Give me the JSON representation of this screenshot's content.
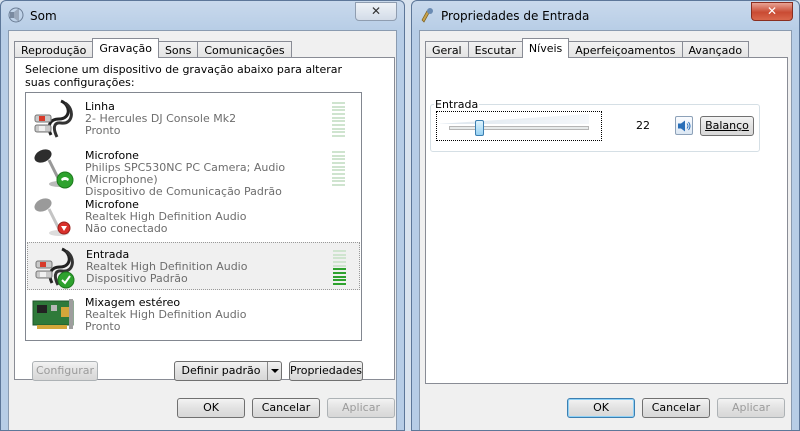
{
  "sound_window": {
    "title": "Som",
    "close_label": "✕",
    "tabs": [
      {
        "label": "Reprodução"
      },
      {
        "label": "Gravação"
      },
      {
        "label": "Sons"
      },
      {
        "label": "Comunicações"
      }
    ],
    "instructions": "Selecione um dispositivo de gravação abaixo para alterar suas configurações:",
    "devices": [
      {
        "name": "Linha",
        "line2": "2- Hercules DJ Console Mk2",
        "line3": "Pronto",
        "icon": "rca-cable-icon"
      },
      {
        "name": "Microfone",
        "line2": "Philips SPC530NC PC Camera; Audio (Microphone)",
        "line3": "Dispositivo de Comunicação Padrão",
        "icon": "microphone-phone-icon"
      },
      {
        "name": "Microfone",
        "line2": "Realtek High Definition Audio",
        "line3": "Não conectado",
        "icon": "microphone-disconnected-icon"
      },
      {
        "name": "Entrada",
        "line2": "Realtek High Definition Audio",
        "line3": "Dispositivo Padrão",
        "icon": "rca-cable-default-icon"
      },
      {
        "name": "Mixagem estéreo",
        "line2": "Realtek High Definition Audio",
        "line3": "Pronto",
        "icon": "sound-card-icon"
      }
    ],
    "buttons": {
      "configure": "Configurar",
      "set_default": "Definir padrão",
      "properties": "Propriedades",
      "ok": "OK",
      "cancel": "Cancelar",
      "apply": "Aplicar"
    }
  },
  "properties_window": {
    "title": "Propriedades de Entrada",
    "close_label": "✕",
    "tabs": [
      {
        "label": "Geral"
      },
      {
        "label": "Escutar"
      },
      {
        "label": "Níveis"
      },
      {
        "label": "Aperfeiçoamentos"
      },
      {
        "label": "Avançado"
      }
    ],
    "group_label": "Entrada",
    "level": 22,
    "level_text": "22",
    "balance_label": "Balanço",
    "buttons": {
      "ok": "OK",
      "cancel": "Cancelar",
      "apply": "Aplicar"
    }
  },
  "colors": {
    "accent": "#3c7fb1",
    "meter_lit": "#2ea22e",
    "default_check": "#2ea22e",
    "disconnected": "#d9302b"
  }
}
